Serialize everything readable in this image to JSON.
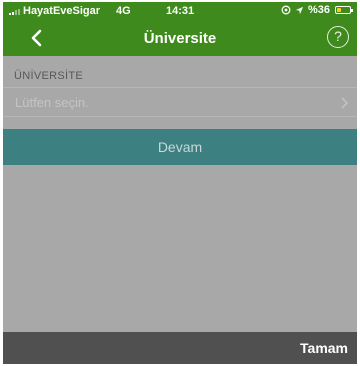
{
  "status_bar": {
    "carrier": "HayatEveSigar",
    "network": "4G",
    "time": "14:31",
    "battery_text": "%36",
    "battery_level": 0.36,
    "icons": [
      "signal-icon",
      "location-icon",
      "navigation-arrow-icon",
      "battery-icon"
    ]
  },
  "nav": {
    "title": "Üniversite",
    "back_icon": "chevron-left-icon",
    "help_symbol": "?"
  },
  "form": {
    "section_label": "ÜNİVERSİTE",
    "select_placeholder": "Lütfen seçin.",
    "chevron_icon": "chevron-right-icon",
    "continue_label": "Devam"
  },
  "toolbar": {
    "done_label": "Tamam"
  },
  "colors": {
    "header_green": "#3f8a1d",
    "button_teal": "#3d8082",
    "overlay_gray": "#a8a8a8",
    "toolbar_gray": "#505050",
    "battery_yellow": "#f7d21c"
  }
}
